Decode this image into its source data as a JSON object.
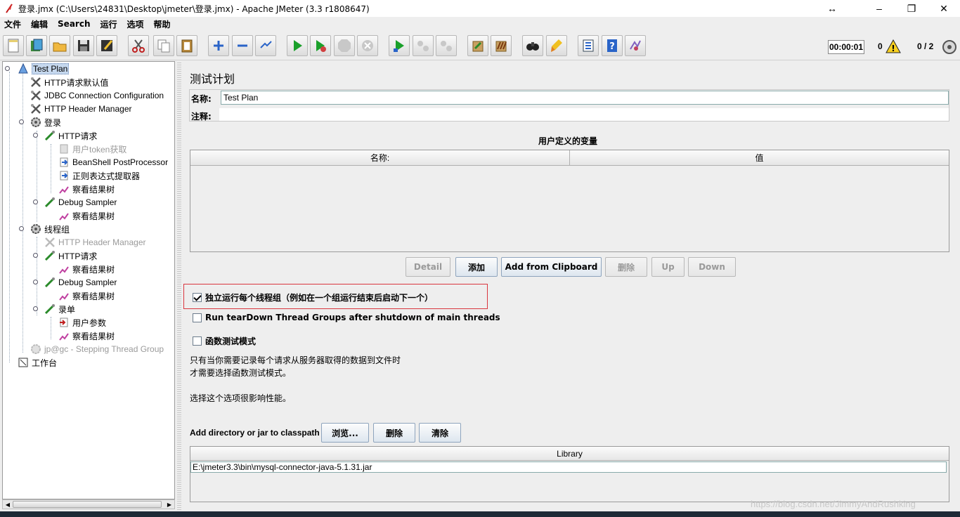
{
  "window": {
    "title": "登录.jmx (C:\\Users\\24831\\Desktop\\jmeter\\登录.jmx) - Apache JMeter (3.3 r1808647)",
    "resize_glyph": "↔",
    "minimize": "–",
    "restore": "❐",
    "close": "✕"
  },
  "menu": [
    "文件",
    "编辑",
    "Search",
    "运行",
    "选项",
    "帮助"
  ],
  "toolbar": {
    "buttons": [
      "new-icon",
      "templates-icon",
      "open-icon",
      "save-icon",
      "save-as-icon",
      "cut-icon",
      "copy-icon",
      "paste-icon",
      "expand-icon",
      "collapse-icon",
      "toggle-icon",
      "start-icon",
      "start-no-pause-icon",
      "stop-icon",
      "shutdown-icon",
      "remote-start-icon",
      "remote-stop-icon",
      "remote-exit-icon",
      "clear-icon",
      "clear-all-icon",
      "search-icon",
      "reset-search-icon",
      "function-helper-icon",
      "help-icon",
      "log-viewer-icon"
    ],
    "timer": "00:00:01",
    "error_count": "0",
    "threads": "0 / 2"
  },
  "tree": {
    "nodes": [
      {
        "label": "Test Plan",
        "icon": "test-plan-icon",
        "depth": 0,
        "selected": true
      },
      {
        "label": "HTTP请求默认值",
        "icon": "config-icon",
        "depth": 1
      },
      {
        "label": "JDBC Connection Configuration",
        "icon": "config-icon",
        "depth": 1
      },
      {
        "label": "HTTP Header Manager",
        "icon": "config-icon",
        "depth": 1
      },
      {
        "label": "登录",
        "icon": "thread-group-icon",
        "depth": 1
      },
      {
        "label": "HTTP请求",
        "icon": "sampler-icon",
        "depth": 2
      },
      {
        "label": "用户token获取",
        "icon": "post-processor-icon",
        "depth": 3,
        "disabled": true
      },
      {
        "label": "BeanShell PostProcessor",
        "icon": "post-processor-icon",
        "depth": 3
      },
      {
        "label": "正则表达式提取器",
        "icon": "post-processor-icon",
        "depth": 3
      },
      {
        "label": "察看结果树",
        "icon": "listener-icon",
        "depth": 3
      },
      {
        "label": "Debug Sampler",
        "icon": "sampler-icon",
        "depth": 2
      },
      {
        "label": "察看结果树",
        "icon": "listener-icon",
        "depth": 3
      },
      {
        "label": "线程组",
        "icon": "thread-group-icon",
        "depth": 1
      },
      {
        "label": "HTTP Header Manager",
        "icon": "config-icon",
        "depth": 2,
        "disabled": true
      },
      {
        "label": "HTTP请求",
        "icon": "sampler-icon",
        "depth": 2
      },
      {
        "label": "察看结果树",
        "icon": "listener-icon",
        "depth": 3
      },
      {
        "label": "Debug Sampler",
        "icon": "sampler-icon",
        "depth": 2
      },
      {
        "label": "察看结果树",
        "icon": "listener-icon",
        "depth": 3
      },
      {
        "label": "录单",
        "icon": "sampler-icon",
        "depth": 2
      },
      {
        "label": "用户参数",
        "icon": "pre-processor-icon",
        "depth": 3
      },
      {
        "label": "察看结果树",
        "icon": "listener-icon",
        "depth": 3
      },
      {
        "label": "jp@gc - Stepping Thread Group",
        "icon": "thread-group-icon",
        "depth": 1,
        "disabled": true
      },
      {
        "label": "工作台",
        "icon": "workbench-icon",
        "depth": 0
      }
    ]
  },
  "main": {
    "title": "测试计划",
    "name_label": "名称:",
    "name_value": "Test Plan",
    "comment_label": "注释:",
    "comment_value": "",
    "variables_title": "用户定义的变量",
    "col_name": "名称:",
    "col_value": "值",
    "buttons": {
      "detail": "Detail",
      "add": "添加",
      "add_clipboard": "Add from Clipboard",
      "delete": "删除",
      "up": "Up",
      "down": "Down"
    },
    "check_independent": "独立运行每个线程组（例如在一个组运行结束后启动下一个）",
    "check_independent_on": true,
    "check_teardown": "Run tearDown Thread Groups after shutdown of main threads",
    "check_functional": "函数测试模式",
    "note1": "只有当你需要记录每个请求从服务器取得的数据到文件时",
    "note2": "才需要选择函数测试模式。",
    "note3": "选择这个选项很影响性能。",
    "classpath_label": "Add directory or jar to classpath",
    "browse": "浏览...",
    "remove": "删除",
    "clear": "清除",
    "library_header": "Library",
    "library_row": "E:\\jmeter3.3\\bin\\mysql-connector-java-5.1.31.jar"
  },
  "watermark": "https://blog.csdn.net/JimmyAndRushking"
}
